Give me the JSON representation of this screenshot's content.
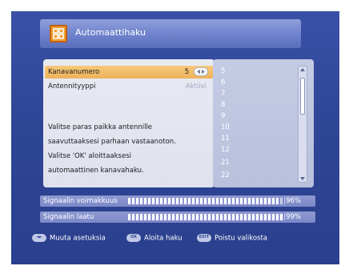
{
  "window": {
    "title": "Automaattihaku",
    "icon": "tv-grid-icon"
  },
  "settings": {
    "channel_number_label": "Kanavanumero",
    "channel_number_value": "5",
    "antenna_type_label": "Antennityyppi",
    "antenna_type_value": "Aktiivi"
  },
  "instructions": [
    "Valitse paras paikka antennille",
    "saavuttaaksesi parhaan vastaanoton.",
    "Valitse 'OK' aloittaaksesi",
    "automaattinen kanavahaku."
  ],
  "channel_list": [
    "5",
    "6",
    "7",
    "8",
    "9",
    "10",
    "11",
    "12",
    "21",
    "22"
  ],
  "signal": {
    "strength_label": "Signaalin voimakkuus",
    "strength_value": 96,
    "strength_text": "96%",
    "quality_label": "Signaalin laatu",
    "quality_value": 99,
    "quality_text": "99%"
  },
  "footer": {
    "change_settings": "Muuta asetuksia",
    "start_search": "Aloita haku",
    "exit_menu": "Poistu valikosta",
    "keys": [
      "◄►",
      "OK",
      "EXIT"
    ]
  },
  "colors": {
    "background": "#2f4596",
    "highlight": "#eeb25a",
    "panel": "#e4e7f0"
  }
}
